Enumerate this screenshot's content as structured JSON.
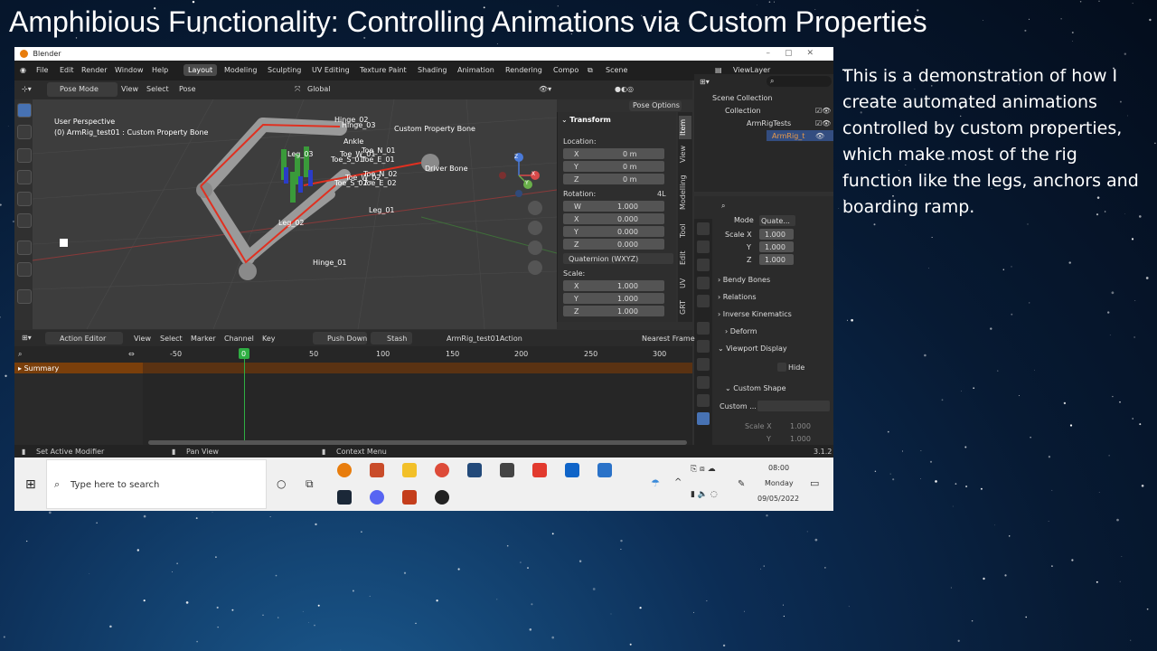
{
  "slide": {
    "title": "Amphibious Functionality: Controlling Animations via Custom Properties",
    "description": "This is a demonstration of how I create automated animations controlled by custom properties, which make most of the rig function like the legs, anchors and boarding ramp."
  },
  "window": {
    "title": "Blender"
  },
  "menubar": {
    "items": [
      "File",
      "Edit",
      "Render",
      "Window",
      "Help"
    ],
    "workspaces": [
      "Layout",
      "Modeling",
      "Sculpting",
      "UV Editing",
      "Texture Paint",
      "Shading",
      "Animation",
      "Rendering",
      "Compo"
    ],
    "active_workspace": "Layout",
    "scene": "Scene",
    "view_layer": "ViewLayer"
  },
  "viewport_header": {
    "mode": "Pose Mode",
    "menus": [
      "View",
      "Select",
      "Pose"
    ],
    "orientation": "Global",
    "pose_options": "Pose Options"
  },
  "viewport": {
    "perspective": "User Perspective",
    "object_info": "(0) ArmRig_test01 : Custom Property Bone",
    "bone_labels": {
      "hinge_02": "Hinge_02",
      "hinge_03": "Hinge_03",
      "custom_property_bone": "Custom Property Bone",
      "ankle": "Ankle",
      "toe_n_01": "Toe_N_01",
      "toe_w_01": "Toe_W_01",
      "toe_s_01": "Toe_S_01",
      "toe_e_01": "Toe_E_01",
      "leg_03": "Leg_03",
      "driver_bone": "Driver Bone",
      "toe_n_02": "Toe_N_02",
      "toe_w_02": "Toe_W_02",
      "toe_s_02": "Toe_S_02",
      "toe_e_02": "Toe_E_02",
      "leg_01": "Leg_01",
      "leg_02": "Leg_02",
      "hinge_01": "Hinge_01"
    },
    "gizmo_axes": [
      "X",
      "Y",
      "Z"
    ]
  },
  "transform_panel": {
    "title": "Transform",
    "location_label": "Location:",
    "location": [
      {
        "axis": "X",
        "value": "0 m"
      },
      {
        "axis": "Y",
        "value": "0 m"
      },
      {
        "axis": "Z",
        "value": "0 m"
      }
    ],
    "rotation_label": "Rotation:",
    "rotation_mode_short": "4L",
    "rotation": [
      {
        "axis": "W",
        "value": "1.000"
      },
      {
        "axis": "X",
        "value": "0.000"
      },
      {
        "axis": "Y",
        "value": "0.000"
      },
      {
        "axis": "Z",
        "value": "0.000"
      }
    ],
    "rotation_mode": "Quaternion (WXYZ)",
    "scale_label": "Scale:",
    "scale": [
      {
        "axis": "X",
        "value": "1.000"
      },
      {
        "axis": "Y",
        "value": "1.000"
      },
      {
        "axis": "Z",
        "value": "1.000"
      }
    ]
  },
  "sidebar_tabs": [
    "Item",
    "View",
    "Modelling",
    "Tool",
    "Edit",
    "UV",
    "GRT"
  ],
  "outliner": {
    "scene_collection": "Scene Collection",
    "collection": "Collection",
    "sub_collection": "ArmRigTests",
    "object": "ArmRig_t"
  },
  "properties": {
    "mode_label": "Mode",
    "mode_value": "Quate...",
    "scale": [
      {
        "axis": "Scale X",
        "value": "1.000"
      },
      {
        "axis": "Y",
        "value": "1.000"
      },
      {
        "axis": "Z",
        "value": "1.000"
      }
    ],
    "sections": [
      "Bendy Bones",
      "Relations",
      "Inverse Kinematics",
      "Deform",
      "Viewport Display"
    ],
    "hide_label": "Hide",
    "custom_shape_title": "Custom Shape",
    "custom_field_label": "Custom ...",
    "custom_scale": [
      {
        "axis": "Scale X",
        "value": "1.000"
      },
      {
        "axis": "Y",
        "value": "1.000"
      }
    ]
  },
  "action_editor": {
    "editor": "Action Editor",
    "menus": [
      "View",
      "Select",
      "Marker",
      "Channel",
      "Key"
    ],
    "push_down": "Push Down",
    "stash": "Stash",
    "action": "ArmRig_test01Action",
    "snapping": "Nearest Frame",
    "frames": [
      "-50",
      "0",
      "50",
      "100",
      "150",
      "200",
      "250",
      "300"
    ],
    "current_frame": "0",
    "summary": "Summary"
  },
  "statusbar": {
    "left": "Set Active Modifier",
    "middle": "Pan View",
    "right": "Context Menu",
    "version": "3.1.2"
  },
  "taskbar": {
    "search_placeholder": "Type here to search",
    "time": "08:00",
    "day": "Monday",
    "date": "09/05/2022"
  },
  "colors": {
    "blender_bg": "#303030",
    "accent_blue": "#4772b3",
    "timeline_summary": "#7a3f0b",
    "playhead": "#2fae43",
    "rig_red": "#e03020"
  }
}
